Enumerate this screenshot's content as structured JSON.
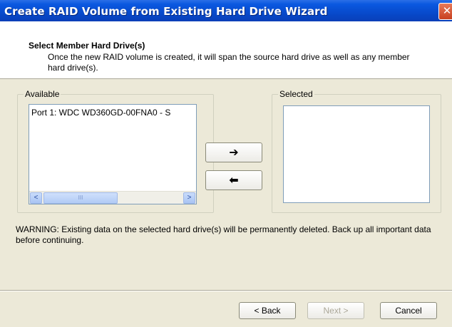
{
  "window": {
    "title": "Create RAID Volume from Existing Hard Drive Wizard",
    "close_glyph": "✕"
  },
  "header": {
    "title": "Select Member Hard Drive(s)",
    "description": "Once the new RAID volume is created, it will span the source hard drive as well as any member hard drive(s)."
  },
  "available": {
    "label": "Available",
    "items": [
      "Port 1: WDC WD360GD-00FNA0 - S"
    ],
    "scroll_left": "<",
    "scroll_right": ">",
    "scroll_thumb_grip": "III"
  },
  "selected": {
    "label": "Selected",
    "items": []
  },
  "move_buttons": {
    "add_glyph": "➔",
    "remove_glyph": "⬅"
  },
  "warning": "WARNING: Existing data on the selected hard drive(s) will be permanently deleted. Back up all important data before continuing.",
  "footer": {
    "back_label": "< Back",
    "next_label": "Next >",
    "cancel_label": "Cancel"
  }
}
